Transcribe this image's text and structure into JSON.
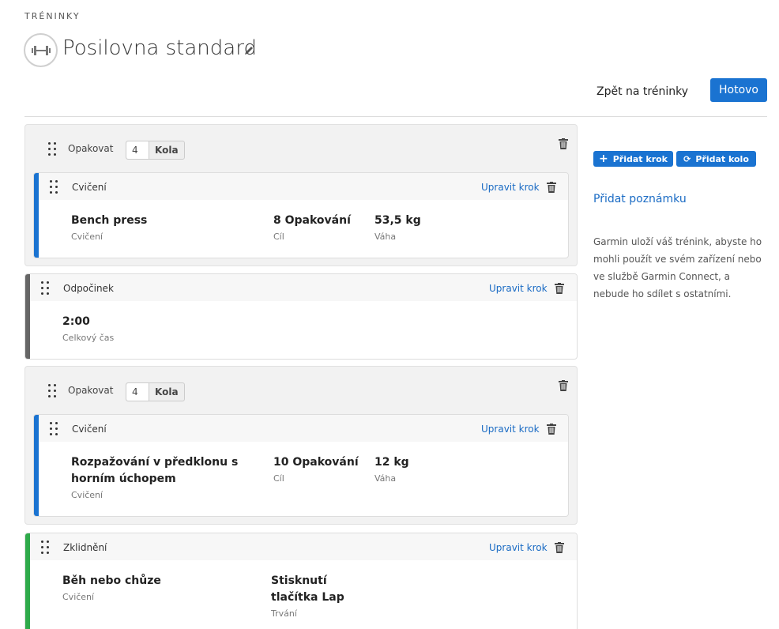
{
  "header": {
    "section": "TRÉNINKY",
    "title": "Posilovna standard",
    "title_icon": "dumbbell-icon",
    "back_label": "Zpět na tréninky",
    "done_label": "Hotovo"
  },
  "sidebar": {
    "add_step_label": "Přidat krok",
    "add_round_label": "Přidat kolo",
    "add_note_label": "Přidat poznámku",
    "info_text": "Garmin uloží váš trénink, abyste ho mohli použít ve svém zařízení nebo ve službě Garmin Connect, a nebude ho sdílet s ostatními."
  },
  "colors": {
    "accent": "#1a73d1",
    "exercise_bar": "#1a73d1",
    "rest_bar": "#666666",
    "cooldown_bar": "#2eaa4a"
  },
  "steps": [
    {
      "repeat_label": "Opakovat",
      "rounds_value": "4",
      "rounds_unit": "Kola",
      "card": {
        "type": "Cvičení",
        "edit_label": "Upravit krok",
        "name": "Bench press",
        "name_sub": "Cvičení",
        "target": "8 Opakování",
        "target_sub": "Cíl",
        "weight": "53,5 kg",
        "weight_sub": "Váha"
      }
    },
    {
      "type": "Odpočinek",
      "edit_label": "Upravit krok",
      "value": "2:00",
      "value_sub": "Celkový čas"
    },
    {
      "repeat_label": "Opakovat",
      "rounds_value": "4",
      "rounds_unit": "Kola",
      "card": {
        "type": "Cvičení",
        "edit_label": "Upravit krok",
        "name": "Rozpažování v předklonu s horním úchopem",
        "name_sub": "Cvičení",
        "target": "10 Opakování",
        "target_sub": "Cíl",
        "weight": "12 kg",
        "weight_sub": "Váha"
      }
    },
    {
      "type": "Zklidnění",
      "edit_label": "Upravit krok",
      "name": "Běh nebo chůze",
      "name_sub": "Cvičení",
      "duration": "Stisknutí tlačítka Lap",
      "duration_sub": "Trvání"
    }
  ]
}
